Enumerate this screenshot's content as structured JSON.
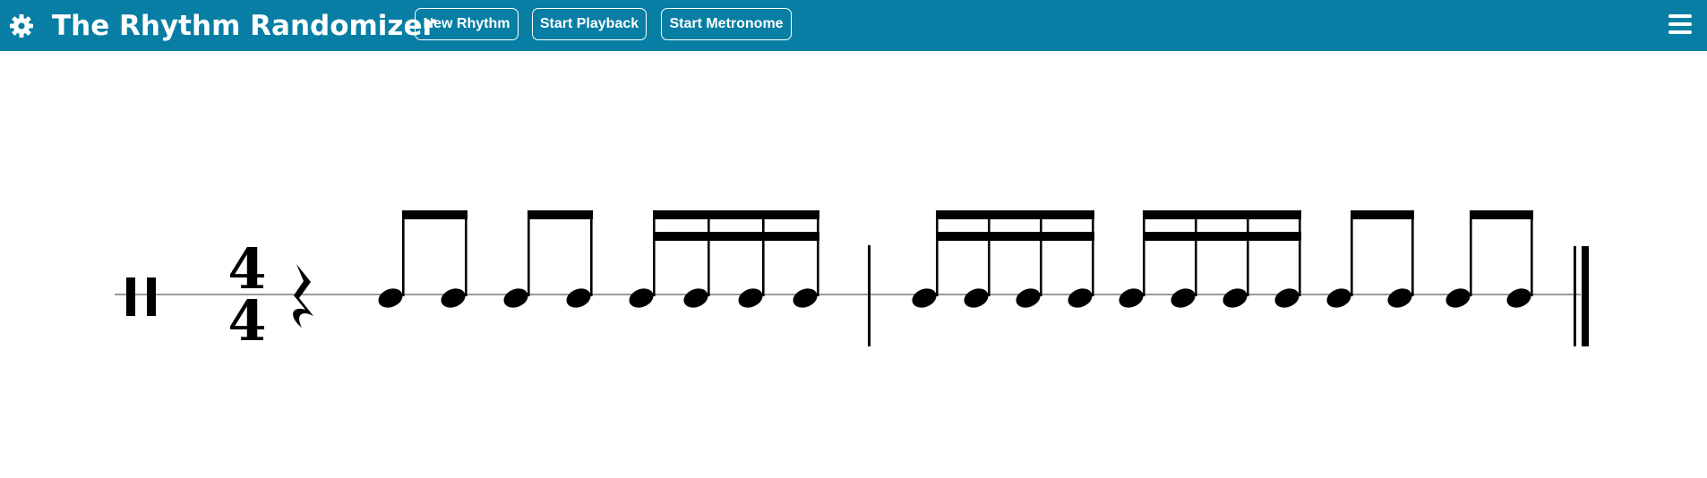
{
  "header": {
    "title": "The Rhythm Randomizer",
    "background_color": "#087ea4",
    "settings_icon": "gear-icon",
    "menu_icon": "hamburger-menu-icon",
    "buttons": {
      "new_rhythm": "New Rhythm",
      "start_playback": "Start Playback",
      "start_metronome": "Start Metronome"
    }
  },
  "score": {
    "clef": "percussion",
    "time_signature": {
      "numerator": "4",
      "denominator": "4"
    },
    "measures": [
      {
        "elements": [
          {
            "type": "rest",
            "duration": "quarter"
          },
          {
            "type": "beamed-group",
            "duration": "eighth",
            "count": 2
          },
          {
            "type": "beamed-group",
            "duration": "eighth",
            "count": 2
          },
          {
            "type": "beamed-group",
            "duration": "sixteenth",
            "count": 4
          }
        ],
        "barline": "single"
      },
      {
        "elements": [
          {
            "type": "beamed-group",
            "duration": "sixteenth",
            "count": 4
          },
          {
            "type": "beamed-group",
            "duration": "sixteenth",
            "count": 4
          },
          {
            "type": "beamed-group",
            "duration": "eighth",
            "count": 2
          },
          {
            "type": "beamed-group",
            "duration": "eighth",
            "count": 2
          }
        ],
        "barline": "final"
      }
    ]
  }
}
